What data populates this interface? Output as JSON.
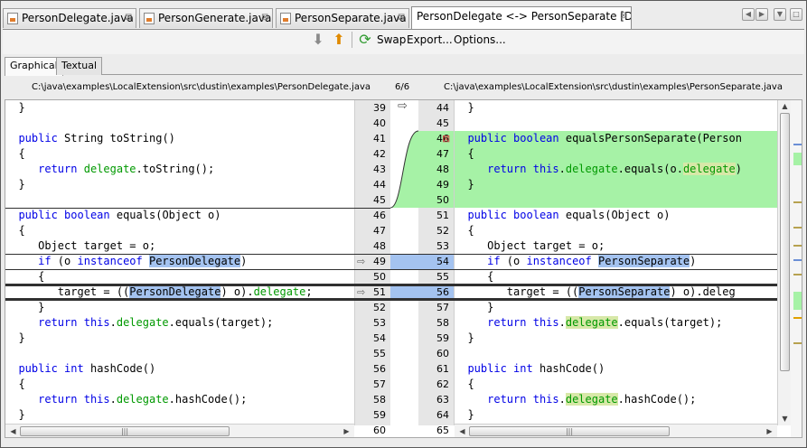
{
  "tabs": [
    {
      "label": "PersonDelegate.java",
      "active": false
    },
    {
      "label": "PersonGenerate.java",
      "active": false
    },
    {
      "label": "PersonSeparate.java",
      "active": false
    },
    {
      "label": "PersonDelegate <-> PersonSeparate [Diff]",
      "active": true
    }
  ],
  "toolbar": {
    "swap_label": "Swap",
    "export_label": "Export...",
    "options_label": "Options..."
  },
  "view_tabs": [
    "Graphical",
    "Textual"
  ],
  "left_path": "C:\\java\\examples\\LocalExtension\\src\\dustin\\examples\\PersonDelegate.java",
  "right_path": "C:\\java\\examples\\LocalExtension\\src\\dustin\\examples\\PersonSeparate.java",
  "diff_counter": "6/6",
  "left_numbers": [
    "39",
    "40",
    "41",
    "42",
    "43",
    "44",
    "45",
    "46",
    "47",
    "48",
    "49",
    "50",
    "51",
    "52",
    "53",
    "54",
    "55",
    "56",
    "57",
    "58",
    "59",
    "60"
  ],
  "right_numbers": [
    "44",
    "45",
    "46",
    "47",
    "48",
    "49",
    "50",
    "51",
    "52",
    "53",
    "54",
    "55",
    "56",
    "57",
    "58",
    "59",
    "60",
    "61",
    "62",
    "63",
    "64",
    "65"
  ],
  "left_code": [
    "  }",
    "",
    "  public String toString()",
    "  {",
    "     return delegate.toString();",
    "  }",
    "",
    "  public boolean equals(Object o)",
    "  {",
    "     Object target = o;",
    "     if (o instanceof PersonDelegate)",
    "     {",
    "        target = ((PersonDelegate) o).delegate;",
    "     }",
    "     return this.delegate.equals(target);",
    "  }",
    "",
    "  public int hashCode()",
    "  {",
    "     return this.delegate.hashCode();",
    "  }",
    ""
  ],
  "right_code": [
    "  }",
    "",
    "  public boolean equalsPersonSeparate(Person",
    "  {",
    "     return this.delegate.equals(o.delegate)",
    "  }",
    "",
    "  public boolean equals(Object o)",
    "  {",
    "     Object target = o;",
    "     if (o instanceof PersonSeparate)",
    "     {",
    "        target = ((PersonSeparate) o).deleg",
    "     }",
    "     return this.delegate.equals(target);",
    "  }",
    "",
    "  public int hashCode()",
    "  {",
    "     return this.delegate.hashCode();",
    "  }",
    ""
  ],
  "colors": {
    "added": "#a6f2a6",
    "changed": "#a4c3f0",
    "field": "#009900",
    "keyword": "#0000e6"
  }
}
